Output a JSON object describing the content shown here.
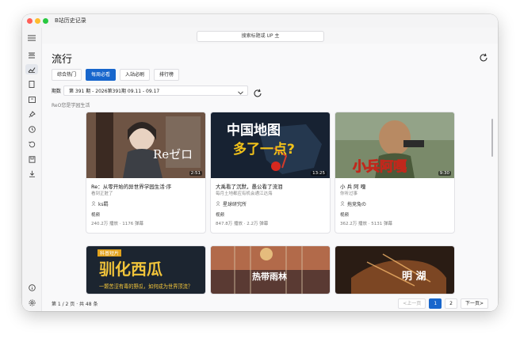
{
  "window": {
    "title": "B站历史记录"
  },
  "search": {
    "placeholder": "搜索标题或 UP 主"
  },
  "page": {
    "title": "流行"
  },
  "tabs": [
    {
      "label": "综合热门",
      "active": false
    },
    {
      "label": "每周必看",
      "active": true
    },
    {
      "label": "入站必刷",
      "active": false
    },
    {
      "label": "排行榜",
      "active": false
    }
  ],
  "period": {
    "label": "期数",
    "value": "第 391 期 - 2026第391期 09.11 - 09.17"
  },
  "section_note": "ReO您是学园生活",
  "cards": [
    {
      "title": "Re：从零开始的异世界学园生活·序",
      "subtitle": "看到正脏了",
      "author": "ks羁",
      "tag": "视频",
      "stats": "240.2万 播放 · 1176 弹幕",
      "duration": "2:51",
      "thumb_text": "Reゼロ"
    },
    {
      "title": "大禹看了沉默，愚公看了流泪",
      "subtitle": "每月土地都应有机会通江达海",
      "author": "星球研究所",
      "tag": "视频",
      "stats": "847.8万 播放 · 2.2万 弹幕",
      "duration": "13:25",
      "thumb_text": "中国地图",
      "thumb_text2": "多了一点?"
    },
    {
      "title": "小 兵 阿 嘎",
      "subtitle": "你听过事",
      "author": "拖竞兔の",
      "tag": "视频",
      "stats": "362.2万 播放 · 5131 弹幕",
      "duration": "9:30",
      "thumb_text": "小兵阿嘎"
    }
  ],
  "cards_row2": [
    {
      "thumb_text": "驯化西瓜",
      "thumb_badge": "科普短片",
      "thumb_sub": "一颗苦涩有毒的野瓜，如何成为世界顶流？"
    },
    {
      "thumb_text": "热带雨林"
    },
    {
      "thumb_text": "明 湖"
    }
  ],
  "footer": {
    "page_info": "第 1 / 2 页 · 共 48 条",
    "prev": "<上一页",
    "pages": [
      "1",
      "2"
    ],
    "next": "下一页>"
  },
  "colors": {
    "accent": "#1766cc"
  },
  "icons": [
    "menu-icon",
    "trending-icon",
    "chart-icon",
    "bookmark-icon",
    "tv-icon",
    "pin-icon",
    "clock-icon",
    "history-icon",
    "archive-icon",
    "download-icon",
    "info-icon",
    "settings-icon",
    "refresh-icon",
    "chevron-down-icon",
    "user-icon"
  ]
}
